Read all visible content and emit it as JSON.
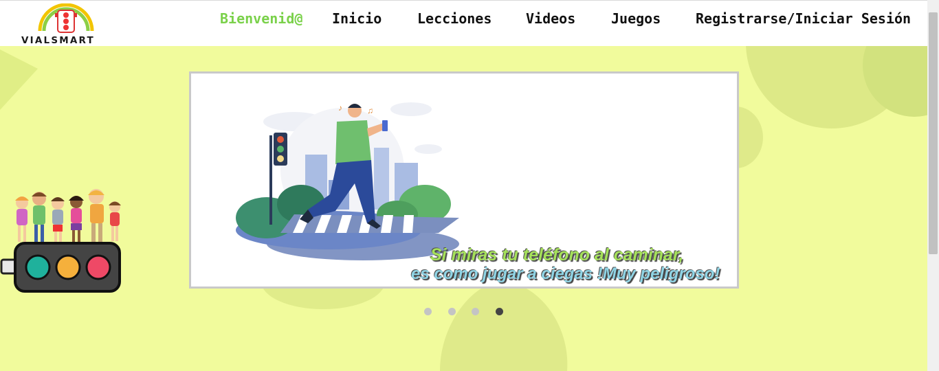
{
  "header": {
    "logo_text": "VIALSMART",
    "nav": [
      {
        "label": "Bienvenid@",
        "active": true
      },
      {
        "label": "Inicio",
        "active": false
      },
      {
        "label": "Lecciones",
        "active": false
      },
      {
        "label": "Videos",
        "active": false
      },
      {
        "label": "Juegos",
        "active": false
      },
      {
        "label": "Registrarse/Iniciar Sesión",
        "active": false
      }
    ]
  },
  "carousel": {
    "caption_line1": "Si miras tu teléfono al caminar,",
    "caption_line2": "es como jugar a ciegas !Muy peligroso!",
    "slide_count": 4,
    "active_slide": 4
  },
  "colors": {
    "background": "#f1fb9c",
    "accent_green": "#7ad14a",
    "blob": "#d6e985"
  },
  "icons": [
    "traffic-light-logo-icon",
    "traffic-light-kids-illustration",
    "pedestrian-phone-illustration"
  ]
}
